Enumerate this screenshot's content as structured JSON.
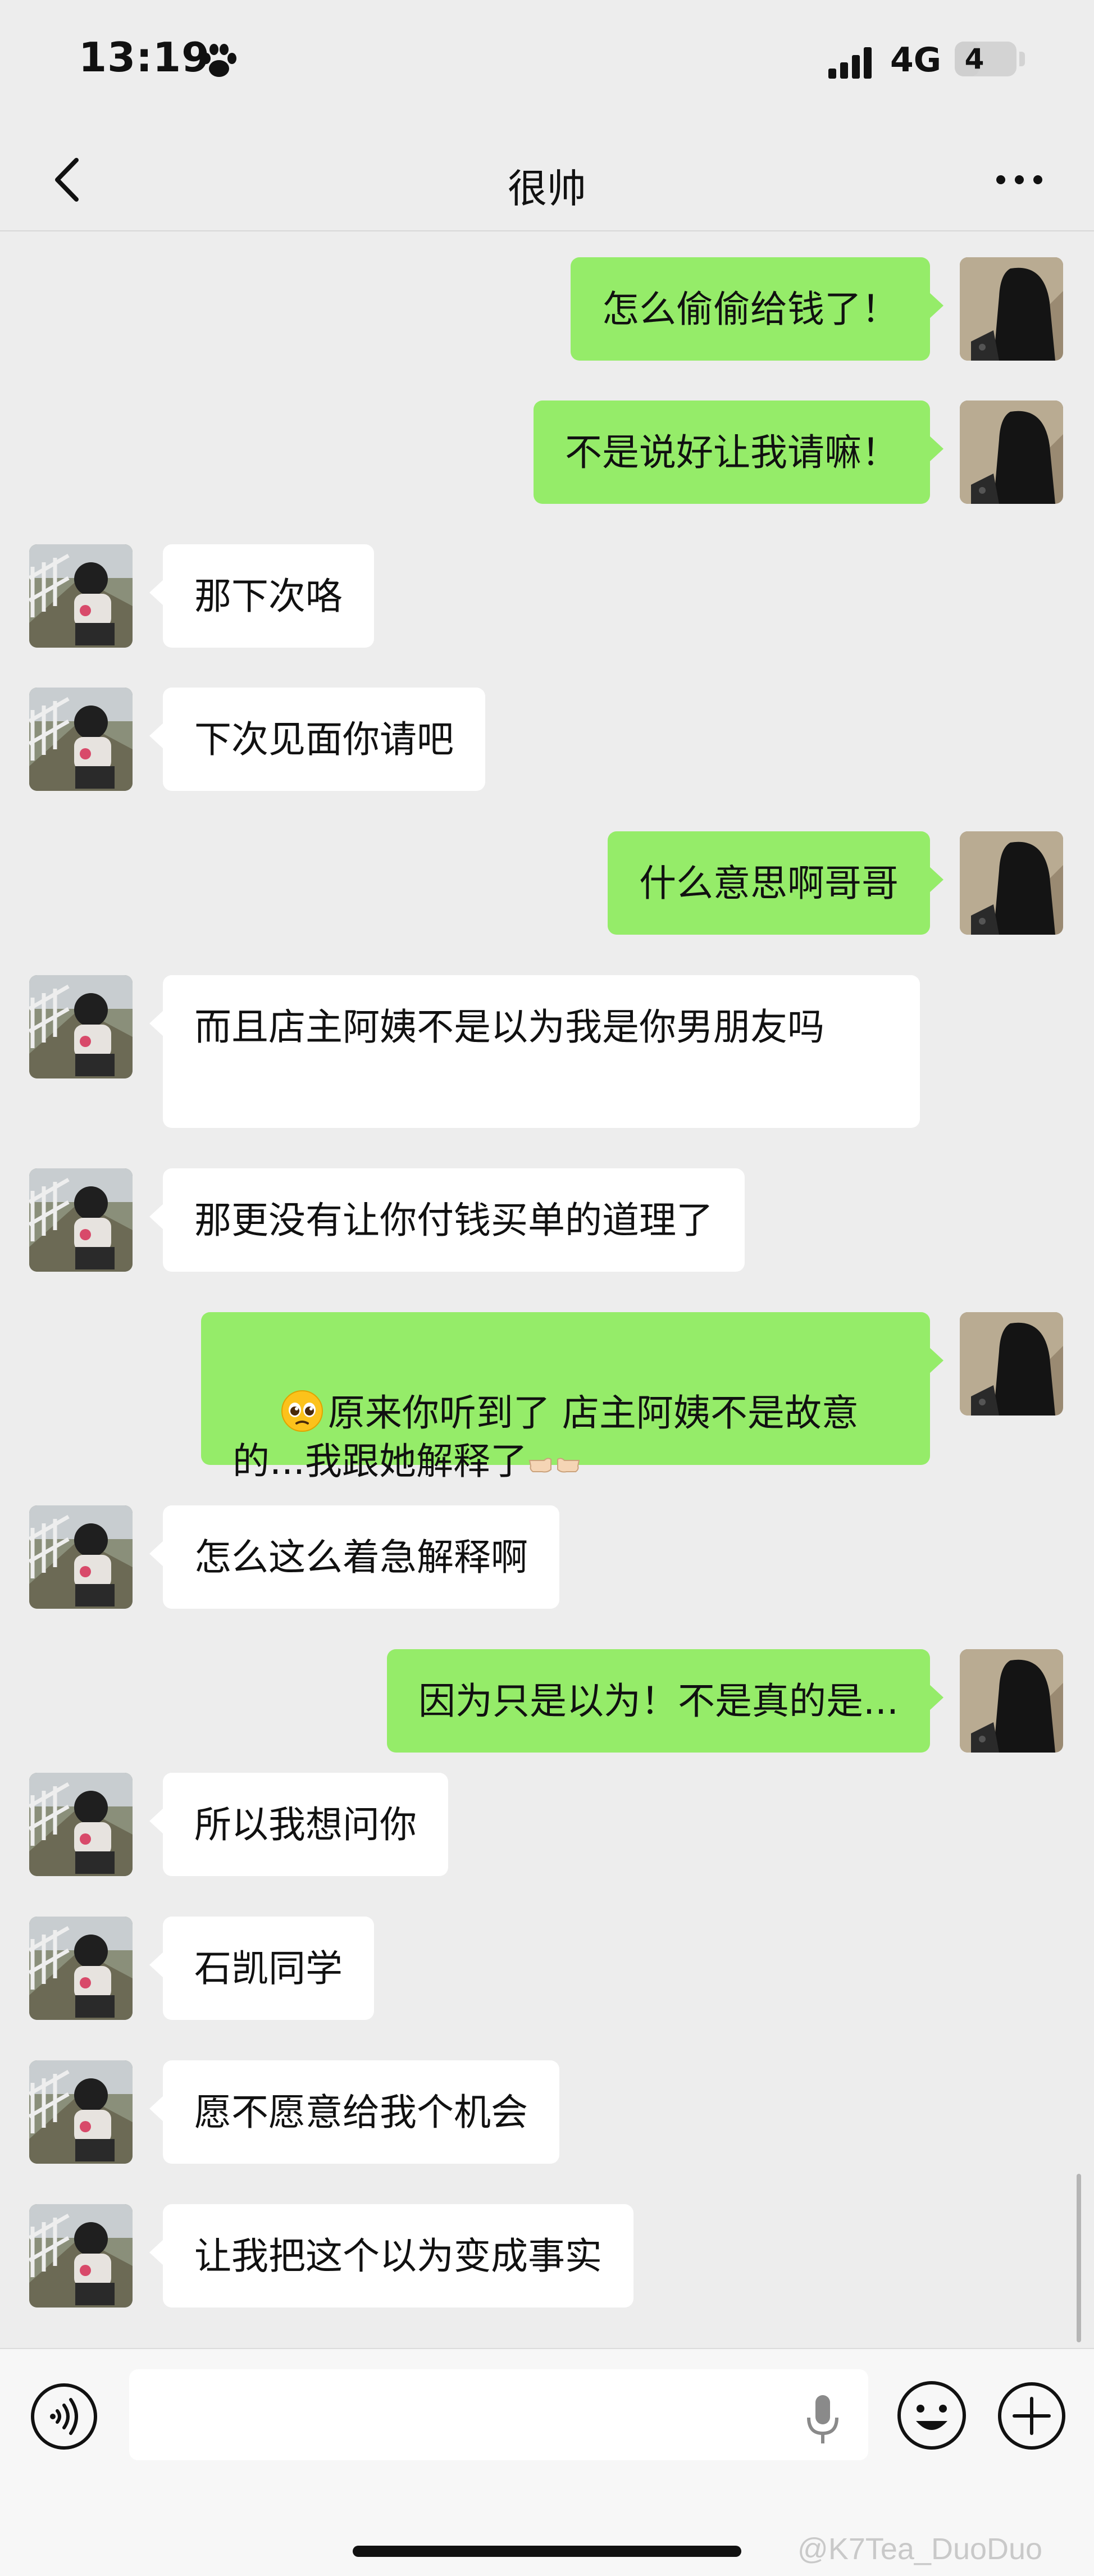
{
  "status_bar": {
    "time": "13:19",
    "network": "4G",
    "battery": "4",
    "battery_level": 0.4
  },
  "header": {
    "title": "很帅"
  },
  "messages": [
    {
      "side": "right",
      "text": "怎么偷偷给钱了！"
    },
    {
      "side": "right",
      "text": "不是说好让我请嘛！"
    },
    {
      "side": "left",
      "text": "那下次咯"
    },
    {
      "side": "left",
      "text": "下次见面你请吧"
    },
    {
      "side": "right",
      "text": "什么意思啊哥哥"
    },
    {
      "side": "left",
      "text": "而且店主阿姨不是以为我是你男朋友吗"
    },
    {
      "side": "left",
      "text": "那更没有让你付钱买单的道理了"
    },
    {
      "side": "right",
      "text_line1": "原来你听到了 店主阿姨不是故意",
      "text_line2": "的...我跟她解释了",
      "emoji_start": "pleading-face",
      "emoji_end": "pointing-fingers"
    },
    {
      "side": "left",
      "text": "怎么这么着急解释啊"
    },
    {
      "side": "right",
      "text": "因为只是以为！不是真的是..."
    },
    {
      "side": "left",
      "text": "所以我想问你"
    },
    {
      "side": "left",
      "text": "石凯同学"
    },
    {
      "side": "left",
      "text": "愿不愿意给我个机会"
    },
    {
      "side": "left",
      "text": "让我把这个以为变成事实"
    }
  ],
  "input_bar": {
    "placeholder": ""
  },
  "watermark": "@K7Tea_DuoDuo",
  "colors": {
    "background": "#ededed",
    "sent_bubble": "#95ec69",
    "received_bubble": "#ffffff"
  }
}
